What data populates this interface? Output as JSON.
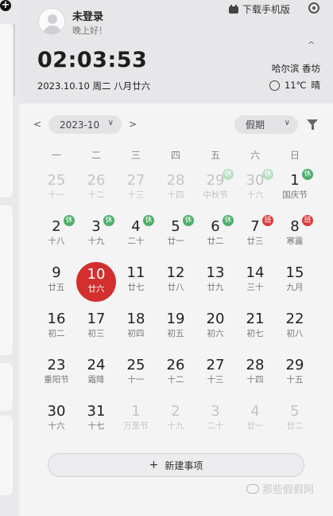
{
  "user": {
    "name": "未登录",
    "greeting": "晚上好！"
  },
  "header": {
    "download_label": "下载手机版"
  },
  "clock": {
    "time": "02:03:53",
    "date": "2023.10.10 周二 八月廿六"
  },
  "weather": {
    "location": "哈尔滨 香坊",
    "temp": "11℃",
    "condition": "晴"
  },
  "toolbar": {
    "month": "2023-10",
    "holiday_filter": "假期"
  },
  "weekdays": [
    "一",
    "二",
    "三",
    "四",
    "五",
    "六",
    "日"
  ],
  "days": [
    {
      "n": "25",
      "s": "十一",
      "dim": true
    },
    {
      "n": "26",
      "s": "十二",
      "dim": true
    },
    {
      "n": "27",
      "s": "十三",
      "dim": true
    },
    {
      "n": "28",
      "s": "十四",
      "dim": true
    },
    {
      "n": "29",
      "s": "中秋节",
      "dim": true,
      "badge": "休"
    },
    {
      "n": "30",
      "s": "十六",
      "dim": true,
      "badge": "休"
    },
    {
      "n": "1",
      "s": "国庆节",
      "badge": "休"
    },
    {
      "n": "2",
      "s": "十八",
      "badge": "休"
    },
    {
      "n": "3",
      "s": "十九",
      "badge": "休"
    },
    {
      "n": "4",
      "s": "二十",
      "badge": "休"
    },
    {
      "n": "5",
      "s": "廿一",
      "badge": "休"
    },
    {
      "n": "6",
      "s": "廿二",
      "badge": "休"
    },
    {
      "n": "7",
      "s": "廿三",
      "badge": "班"
    },
    {
      "n": "8",
      "s": "寒露",
      "badge": "班"
    },
    {
      "n": "9",
      "s": "廿五"
    },
    {
      "n": "10",
      "s": "廿六",
      "today": true
    },
    {
      "n": "11",
      "s": "廿七"
    },
    {
      "n": "12",
      "s": "廿八"
    },
    {
      "n": "13",
      "s": "廿九"
    },
    {
      "n": "14",
      "s": "三十"
    },
    {
      "n": "15",
      "s": "九月"
    },
    {
      "n": "16",
      "s": "初二"
    },
    {
      "n": "17",
      "s": "初三"
    },
    {
      "n": "18",
      "s": "初四"
    },
    {
      "n": "19",
      "s": "初五"
    },
    {
      "n": "20",
      "s": "初六"
    },
    {
      "n": "21",
      "s": "初七"
    },
    {
      "n": "22",
      "s": "初八"
    },
    {
      "n": "23",
      "s": "重阳节"
    },
    {
      "n": "24",
      "s": "霜降"
    },
    {
      "n": "25",
      "s": "十一"
    },
    {
      "n": "26",
      "s": "十二"
    },
    {
      "n": "27",
      "s": "十三"
    },
    {
      "n": "28",
      "s": "十四"
    },
    {
      "n": "29",
      "s": "十五"
    },
    {
      "n": "30",
      "s": "十六"
    },
    {
      "n": "31",
      "s": "十七"
    },
    {
      "n": "1",
      "s": "万圣节",
      "dim": true
    },
    {
      "n": "2",
      "s": "十九",
      "dim": true
    },
    {
      "n": "3",
      "s": "二十",
      "dim": true
    },
    {
      "n": "4",
      "s": "廿一",
      "dim": true
    },
    {
      "n": "5",
      "s": "廿二",
      "dim": true
    }
  ],
  "actions": {
    "new_event_label": "新建事项"
  },
  "watermark": {
    "text": "那些假假网"
  },
  "colors": {
    "today": "#d32f2f",
    "rest_badge": "#4caf6a",
    "work_badge": "#d83b3b"
  }
}
